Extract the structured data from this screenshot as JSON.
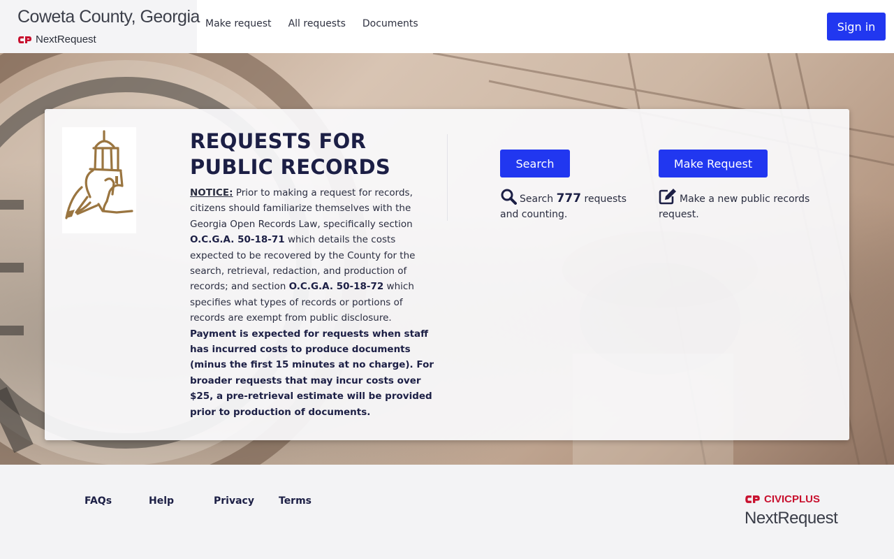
{
  "header": {
    "org_title": "Coweta County, Georgia",
    "product": "NextRequest",
    "nav": [
      "Make request",
      "All requests",
      "Documents"
    ],
    "sign_in": "Sign in"
  },
  "hero": {
    "title": "REQUESTS FOR PUBLIC RECORDS",
    "notice": {
      "label": "NOTICE:",
      "p1": " Prior to making a request for records, citizens should familiarize themselves with the Georgia Open Records Law, specifically section ",
      "code1": "O.C.G.A. 50-18-71",
      "p2": " which details the costs expected to be recovered by the County for the search, retrieval, redaction, and production of records; and section ",
      "code2": "O.C.G.A. 50-18-72",
      "p3": " which specifies what types of records or portions of records are exempt from public disclosure. ",
      "bold": "Payment is expected for requests when staff has incurred costs to produce documents (minus the first 15 minutes at no charge). For broader requests that may incur costs over $25, a pre-retrieval estimate will be provided prior to production of documents."
    },
    "search": {
      "button": "Search",
      "prefix": "Search",
      "count": "777",
      "suffix": "requests and counting."
    },
    "make_request": {
      "button": "Make Request",
      "text": "Make a new public records request."
    }
  },
  "footer": {
    "links": [
      "FAQs",
      "Help",
      "Privacy",
      "Terms"
    ],
    "civic_brand": "CIVICPLUS",
    "product": "NextRequest"
  },
  "colors": {
    "primary": "#2137f0",
    "title": "#1c1f45",
    "brand_red": "#c8102e",
    "seal_gold": "#9a7540"
  }
}
